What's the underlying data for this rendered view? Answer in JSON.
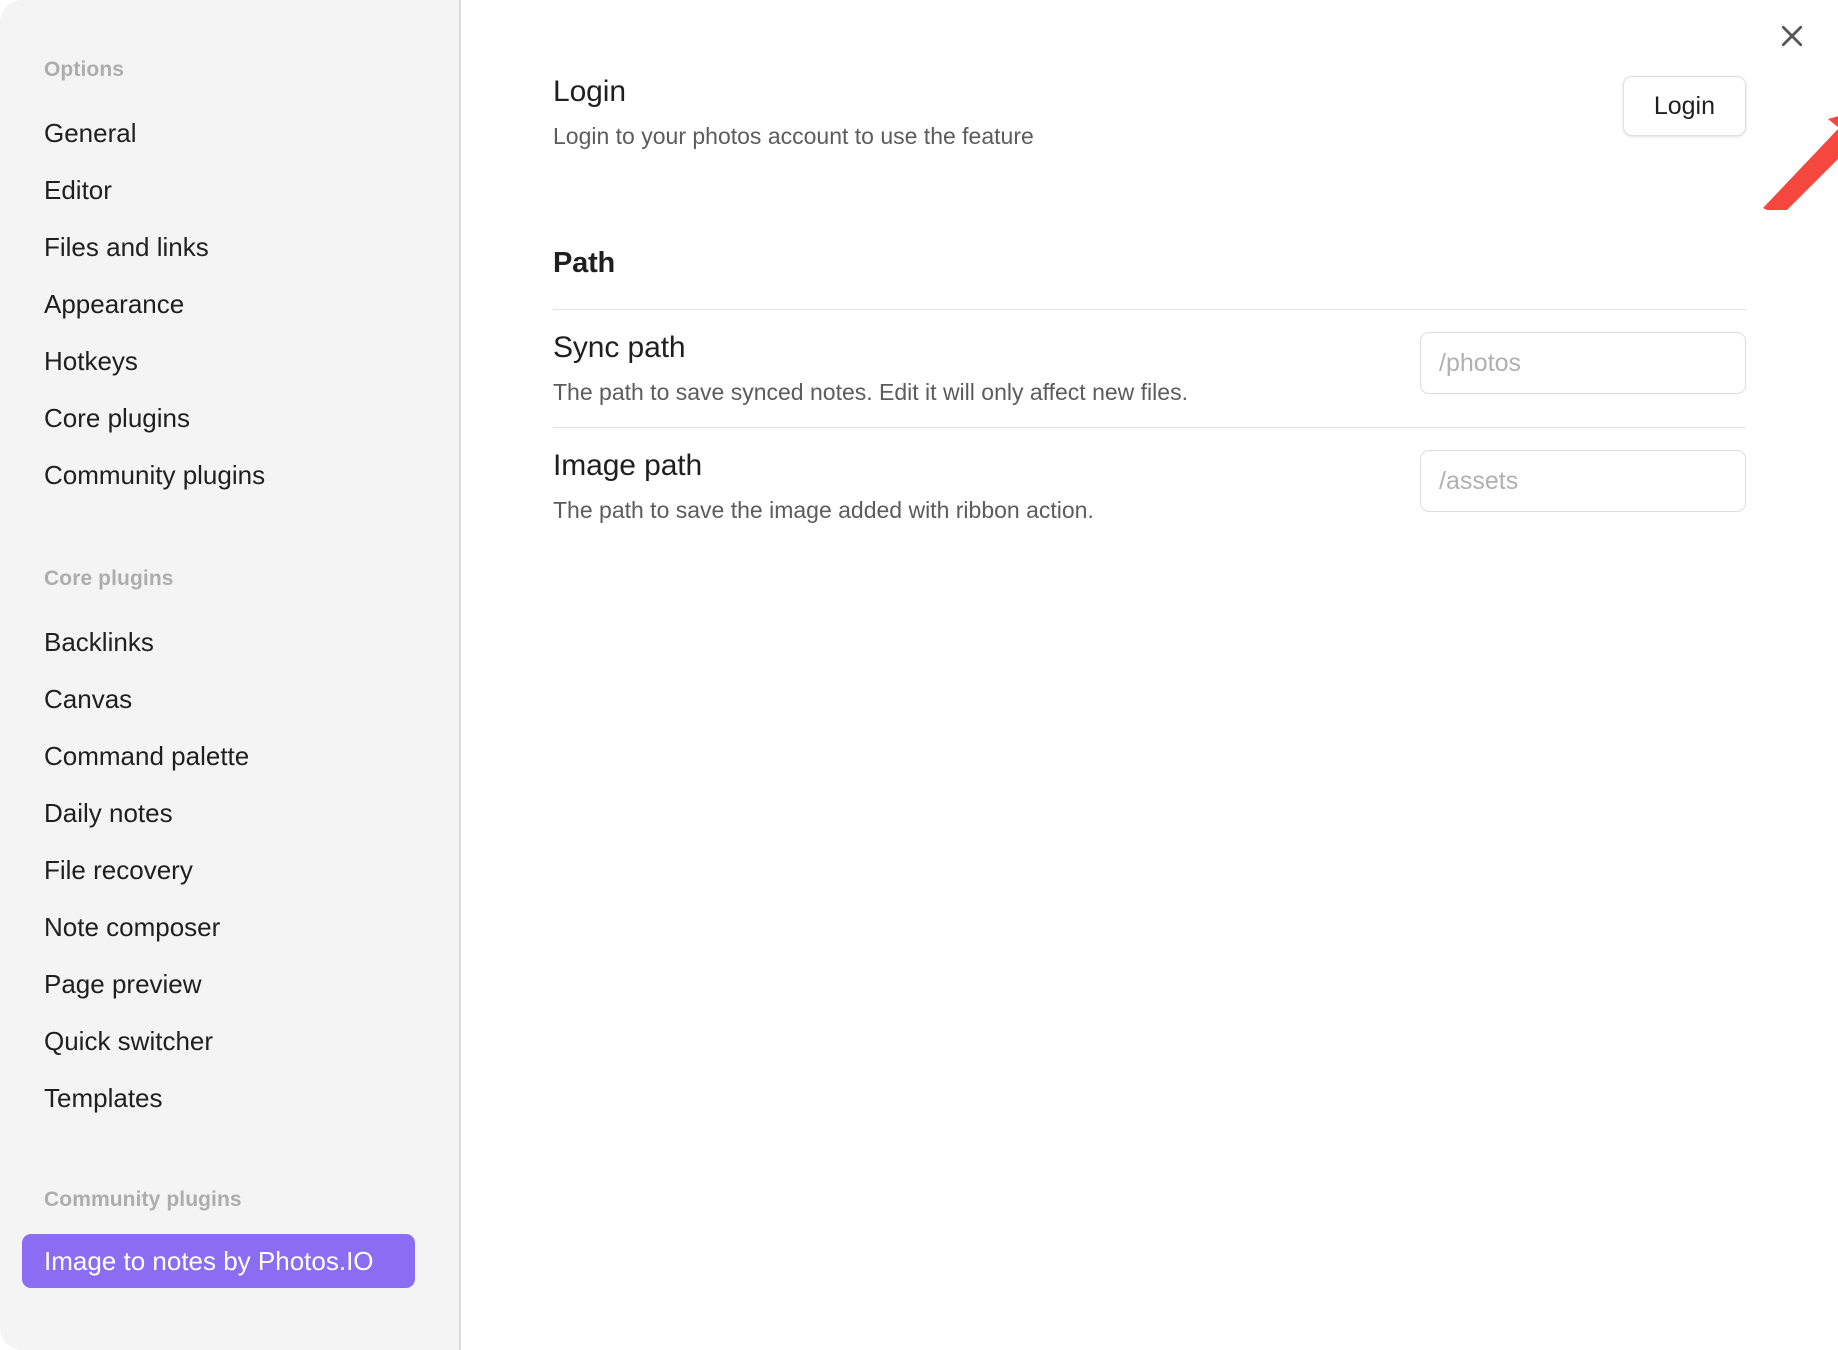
{
  "sidebar": {
    "groups": [
      {
        "title": "Options",
        "items": [
          {
            "label": "General"
          },
          {
            "label": "Editor"
          },
          {
            "label": "Files and links"
          },
          {
            "label": "Appearance"
          },
          {
            "label": "Hotkeys"
          },
          {
            "label": "Core plugins"
          },
          {
            "label": "Community plugins"
          }
        ]
      },
      {
        "title": "Core plugins",
        "items": [
          {
            "label": "Backlinks"
          },
          {
            "label": "Canvas"
          },
          {
            "label": "Command palette"
          },
          {
            "label": "Daily notes"
          },
          {
            "label": "File recovery"
          },
          {
            "label": "Note composer"
          },
          {
            "label": "Page preview"
          },
          {
            "label": "Quick switcher"
          },
          {
            "label": "Templates"
          }
        ]
      },
      {
        "title": "Community plugins",
        "items": [
          {
            "label": "Image to notes by Photos.IO",
            "active": true
          }
        ]
      }
    ]
  },
  "content": {
    "close_icon": "close-icon",
    "login_setting": {
      "name": "Login",
      "description": "Login to your photos account to use the feature",
      "button_label": "Login"
    },
    "path_section": {
      "heading": "Path",
      "rows": [
        {
          "name": "Sync path",
          "description": "The path to save synced notes. Edit it will only affect new files.",
          "value": "",
          "placeholder": "/photos"
        },
        {
          "name": "Image path",
          "description": "The path to save the image added with ribbon action.",
          "value": "",
          "placeholder": "/assets"
        }
      ]
    }
  },
  "annotation": {
    "type": "arrow",
    "color": "#f4483f",
    "points_to": "login-button"
  },
  "colors": {
    "accent": "#8a6df2",
    "sidebar_bg": "#f4f4f4",
    "content_bg": "#ffffff",
    "muted_text": "#adadad",
    "body_text": "#1f1f1f",
    "annotation_red": "#f4483f"
  }
}
